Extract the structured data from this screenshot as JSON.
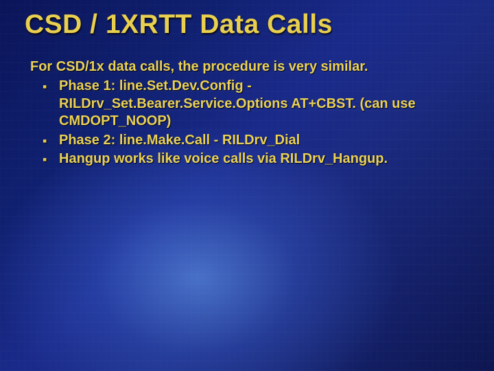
{
  "title": "CSD / 1XRTT Data Calls",
  "intro": "For CSD/1x data calls, the procedure is very similar.",
  "bullets": [
    "Phase 1: line.Set.Dev.Config - RILDrv_Set.Bearer.Service.Options  AT+CBST.  (can use CMDOPT_NOOP)",
    "Phase 2: line.Make.Call - RILDrv_Dial",
    "Hangup works like voice calls via RILDrv_Hangup."
  ]
}
